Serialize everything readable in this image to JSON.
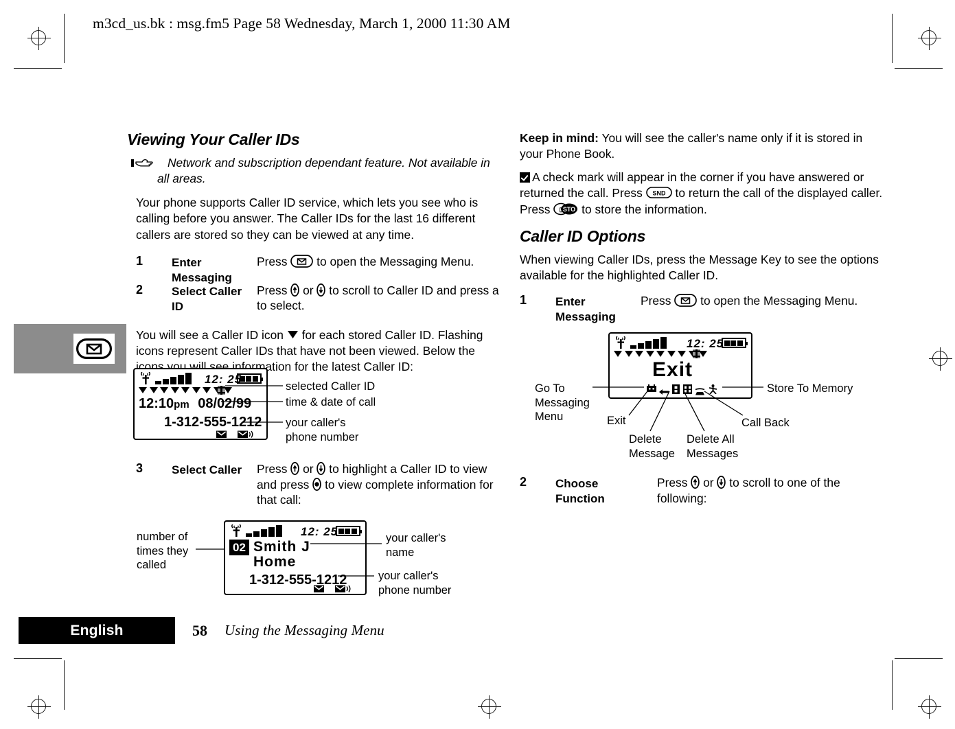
{
  "header": {
    "text": "m3cd_us.bk : msg.fm5  Page 58  Wednesday, March 1, 2000  11:30 AM"
  },
  "tab": {
    "icon": "envelope-key-icon"
  },
  "left_column": {
    "heading": "Viewing Your Caller IDs",
    "note": "Network and subscription dependant feature. Not available in all areas.",
    "intro": "Your phone supports Caller ID service, which lets you see who is calling before you answer. The Caller IDs for the last 16 different callers are stored so they can be viewed at any time.",
    "steps": [
      {
        "num": "1",
        "title": "Enter Messaging",
        "text_before": "Press",
        "text_after": "to open the Messaging Menu."
      },
      {
        "num": "2",
        "title": "Select Caller ID",
        "text_before": "Press",
        "text_mid": "or",
        "text_after": "to scroll to Caller ID and press a to select."
      }
    ],
    "icon_paragraph_a": "You will see a Caller ID icon",
    "icon_paragraph_b": "for each stored Caller ID. Flashing icons represent Caller IDs that have not been viewed. Below the icons you will see information for the latest Caller ID:",
    "step3": {
      "num": "3",
      "title": "Select Caller",
      "text_before": "Press",
      "text_mid": "or",
      "text_mid2": "to highlight a Caller ID to view and press",
      "text_after": "to view complete information for that call:"
    }
  },
  "lcd1": {
    "clock": "12: 25",
    "signal_bars": 5,
    "battery_segments": 3,
    "caller_triangles": 9,
    "line1": "12:10",
    "line1_suffix": "pm",
    "line1_date": "08/02/99",
    "line2": "1-312-555-1212",
    "callouts": [
      "selected Caller ID",
      "time & date of call",
      "your caller's phone number"
    ]
  },
  "lcd2": {
    "clock": "12: 25",
    "signal_bars": 5,
    "battery_segments": 3,
    "count_badge": "02",
    "name": "Smith J",
    "label": "Home",
    "number": "1-312-555-1212",
    "callout_left": "number of times they called",
    "callout_name": "your caller's name",
    "callout_number": "your caller's phone number"
  },
  "right_column": {
    "keep_in_mind_label": "Keep in mind:",
    "keep_in_mind_text": "You will see the caller's name only if it is stored in your Phone Book.",
    "checkmark_text_a": "A check mark will appear in the corner if you have answered or returned the call. Press",
    "checkmark_text_b": "to return the call of the displayed caller. Press",
    "checkmark_text_c": "to store the information.",
    "heading": "Caller ID Options",
    "intro": "When viewing Caller IDs, press the Message Key to see the options available for the highlighted Caller ID.",
    "steps": [
      {
        "num": "1",
        "title": "Enter Messaging",
        "text_before": "Press",
        "text_after": "to open the Messaging Menu."
      },
      {
        "num": "2",
        "title": "Choose Function",
        "text_before": "Press",
        "text_mid": "or",
        "text_after": "to scroll to one of the following:"
      }
    ]
  },
  "lcd3": {
    "clock": "12: 25",
    "signal_bars": 5,
    "battery_segments": 3,
    "caller_triangles": 9,
    "big_text": "Exit",
    "option_icons": [
      "go-to-messaging-menu-icon",
      "exit-icon",
      "delete-message-icon",
      "delete-all-messages-icon",
      "call-back-icon",
      "store-to-memory-icon"
    ],
    "callouts": {
      "go_to_messaging": "Go To Messaging Menu",
      "store_to_memory": "Store To Memory",
      "exit": "Exit",
      "call_back": "Call Back",
      "delete_message": "Delete Message",
      "delete_all": "Delete All Messages"
    }
  },
  "footer": {
    "language": "English",
    "page_number": "58",
    "section_title": "Using the Messaging Menu"
  }
}
